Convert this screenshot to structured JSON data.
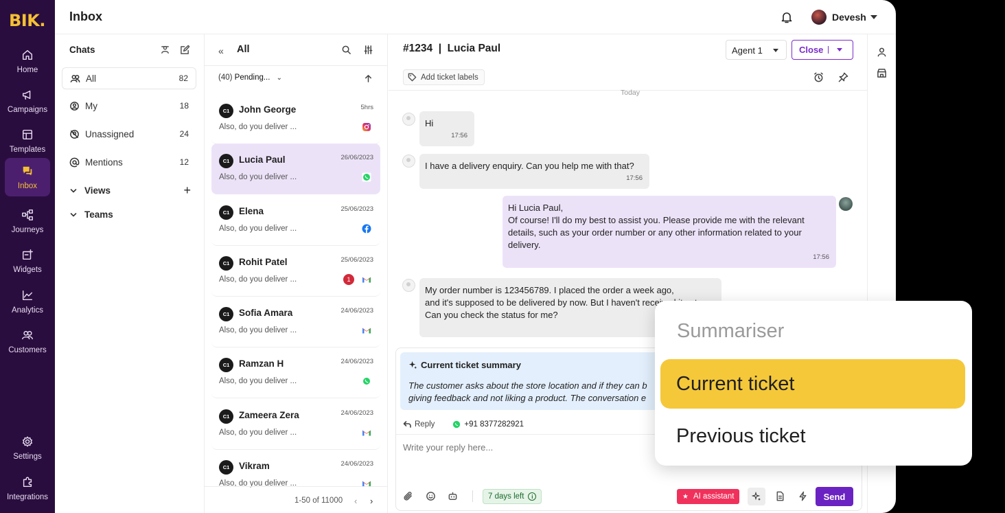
{
  "brand": "BIK.",
  "nav": {
    "items": [
      {
        "label": "Home",
        "icon": "home-icon"
      },
      {
        "label": "Campaigns",
        "icon": "megaphone-icon"
      },
      {
        "label": "Templates",
        "icon": "template-icon"
      },
      {
        "label": "Inbox",
        "icon": "inbox-icon"
      },
      {
        "label": "Journeys",
        "icon": "journey-icon"
      },
      {
        "label": "Widgets",
        "icon": "widget-icon"
      },
      {
        "label": "Analytics",
        "icon": "analytics-icon"
      },
      {
        "label": "Customers",
        "icon": "customers-icon"
      }
    ],
    "bottom": [
      {
        "label": "Settings",
        "icon": "gear-icon"
      },
      {
        "label": "Integrations",
        "icon": "puzzle-icon"
      }
    ],
    "active": "Inbox"
  },
  "header": {
    "title": "Inbox",
    "user": "Devesh"
  },
  "chats": {
    "title": "Chats",
    "folders": [
      {
        "label": "All",
        "count": "82"
      },
      {
        "label": "My",
        "count": "18"
      },
      {
        "label": "Unassigned",
        "count": "24"
      },
      {
        "label": "Mentions",
        "count": "12"
      }
    ],
    "sections": [
      {
        "label": "Views"
      },
      {
        "label": "Teams"
      }
    ]
  },
  "conversations": {
    "title": "All",
    "filter_count": "(40)",
    "filter_label": "Pending...",
    "items": [
      {
        "initials": "C1",
        "name": "John George",
        "time": "5hrs",
        "preview": "Also, do you deliver ...",
        "channel": "instagram-icon"
      },
      {
        "initials": "C1",
        "name": "Lucia Paul",
        "time": "26/06/2023",
        "preview": "Also, do you deliver ...",
        "channel": "whatsapp-icon"
      },
      {
        "initials": "C1",
        "name": "Elena",
        "time": "25/06/2023",
        "preview": "Also, do you deliver ...",
        "channel": "facebook-icon"
      },
      {
        "initials": "C1",
        "name": "Rohit Patel",
        "time": "25/06/2023",
        "preview": "Also, do you deliver ...",
        "channel": "gmail-icon",
        "unread": "1"
      },
      {
        "initials": "C1",
        "name": "Sofia Amara",
        "time": "24/06/2023",
        "preview": "Also, do you deliver ...",
        "channel": "gmail-icon"
      },
      {
        "initials": "C1",
        "name": "Ramzan H",
        "time": "24/06/2023",
        "preview": "Also, do you deliver ...",
        "channel": "whatsapp-icon"
      },
      {
        "initials": "C1",
        "name": "Zameera Zera",
        "time": "24/06/2023",
        "preview": "Also, do you deliver ...",
        "channel": "gmail-icon"
      },
      {
        "initials": "C1",
        "name": "Vikram",
        "time": "24/06/2023",
        "preview": "Also, do you deliver ...",
        "channel": "gmail-icon"
      }
    ],
    "pagination": "1-50 of 11000"
  },
  "ticket": {
    "title": "#1234  |  Lucia Paul",
    "agent": "Agent 1",
    "close_label": "Close",
    "labels_button": "Add ticket labels",
    "day": "Today",
    "messages": [
      {
        "from": "customer",
        "lines": [
          "Hi"
        ],
        "time": "17:56"
      },
      {
        "from": "customer",
        "lines": [
          "I have a delivery enquiry. Can you help me with that?"
        ],
        "time": "17:56"
      },
      {
        "from": "agent",
        "lines": [
          "Hi Lucia Paul,",
          "Of course! I'll do my best to assist you. Please provide me with the relevant",
          "details, such as your order number or any other information related to your",
          "delivery."
        ],
        "time": "17:56"
      },
      {
        "from": "customer",
        "lines": [
          "My order number is 123456789. I placed the order a week ago,",
          "and it's supposed to be delivered by now. But I haven't received it yet.",
          "Can you check the status for me?"
        ],
        "time": ""
      }
    ],
    "summary": {
      "title": "Current ticket summary",
      "line1": "The customer asks about the store location and if they can b",
      "line2": "giving feedback and not liking a product. The conversation e"
    },
    "reply": {
      "reply_label": "Reply",
      "phone": "+91 8377282921",
      "placeholder": "Write your reply here...",
      "sla": "7 days left",
      "ai_label": "AI assistant",
      "send_label": "Send"
    }
  },
  "summariser": {
    "title": "Summariser",
    "options": [
      "Current ticket",
      "Previous ticket"
    ],
    "active": "Current ticket"
  },
  "colors": {
    "rail_bg": "#2a0d3f",
    "brand_yellow": "#f5c033",
    "accent_purple": "#6a22c2",
    "bubble_out": "#ece2f8",
    "summary_bg": "#e3effc",
    "highlight": "#f5c83a"
  }
}
